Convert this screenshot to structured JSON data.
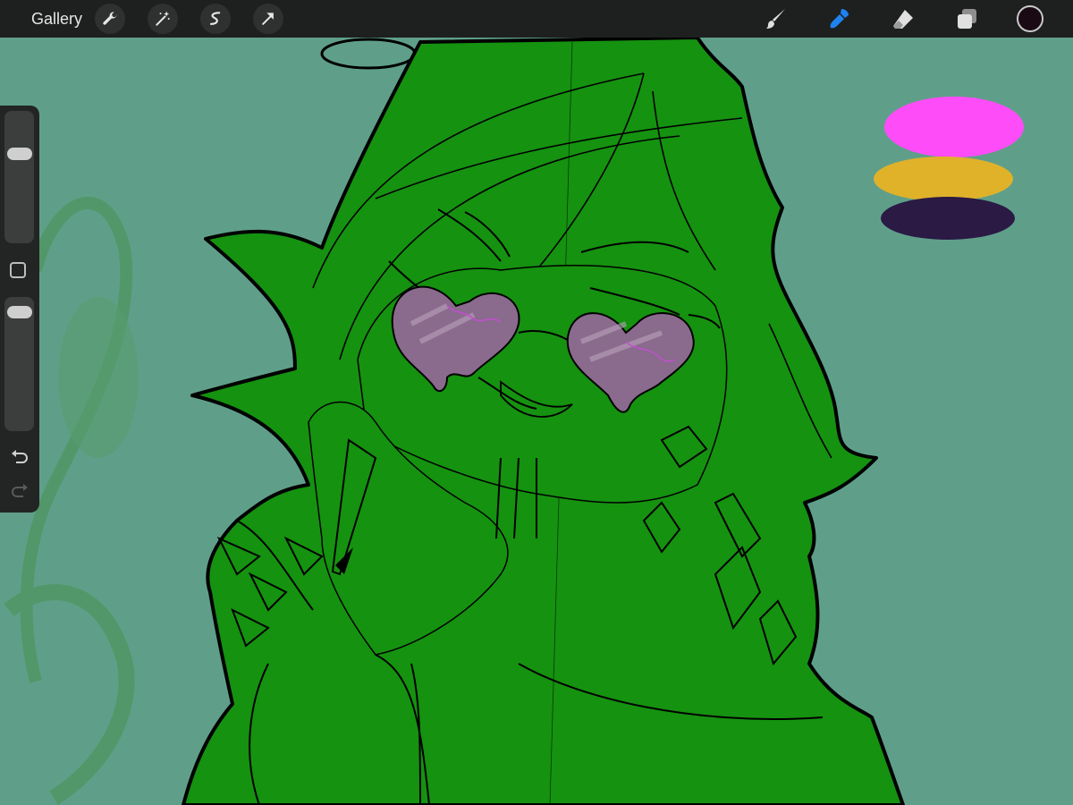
{
  "topbar": {
    "gallery_label": "Gallery",
    "left_tools": [
      "wrench-icon",
      "magic-wand-icon",
      "selection-icon",
      "transform-arrow-icon"
    ],
    "right_tools": [
      "brush-icon",
      "smudge-icon",
      "eraser-icon",
      "layers-icon"
    ],
    "active_tool": "smudge-icon",
    "accent_color": "#1e82f0",
    "current_color": "#1a0a14"
  },
  "sidebar": {
    "brush_size_level": 0.7,
    "opacity_level": 0.95
  },
  "canvas": {
    "background_color": "#5f9f8a",
    "fill_color": "#159210",
    "line_color": "#000000",
    "palette_swatches": [
      "#ff4cf9",
      "#e0b22a",
      "#2a1a44"
    ]
  }
}
